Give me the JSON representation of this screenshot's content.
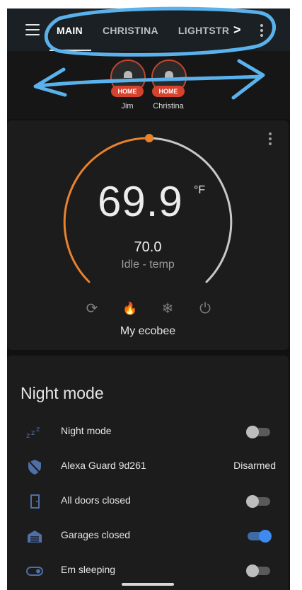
{
  "header": {
    "tabs": [
      {
        "label": "MAIN",
        "active": true
      },
      {
        "label": "CHRISTINA",
        "active": false
      },
      {
        "label": "LIGHTSTR",
        "active": false
      }
    ],
    "chevron": ">",
    "menu_icon": "hamburger-icon",
    "more_icon": "more-vertical-icon"
  },
  "badges": [
    {
      "name": "Jim",
      "state": "HOME"
    },
    {
      "name": "Christina",
      "state": "HOME"
    }
  ],
  "thermostat": {
    "current_temp": "69.9",
    "unit": "°F",
    "target_temp": "70.0",
    "action": "Idle - temp",
    "name": "My ecobee",
    "modes": [
      {
        "icon": "sync-icon",
        "glyph": "⟳",
        "active": false
      },
      {
        "icon": "fire-icon",
        "glyph": "🔥",
        "active": true
      },
      {
        "icon": "snowflake-icon",
        "glyph": "❄",
        "active": false
      },
      {
        "icon": "power-icon",
        "glyph": "⏻",
        "active": false
      }
    ],
    "accent_color": "#e9822d",
    "track_color": "#c8c8c8"
  },
  "entities": {
    "title": "Night mode",
    "rows": [
      {
        "icon": "sleep-icon",
        "label": "Night mode",
        "type": "toggle",
        "on": false
      },
      {
        "icon": "shield-off-icon",
        "label": "Alexa Guard 9d261",
        "type": "state",
        "state": "Disarmed"
      },
      {
        "icon": "door-icon",
        "label": "All doors closed",
        "type": "toggle",
        "on": false
      },
      {
        "icon": "garage-icon",
        "label": "Garages closed",
        "type": "toggle",
        "on": true
      },
      {
        "icon": "toggle-switch-icon",
        "label": "Em sleeping",
        "type": "toggle",
        "on": false
      }
    ]
  },
  "colors": {
    "header_bg": "#1b2025",
    "badge_pill": "#d5432e",
    "toggle_on": "#3d8bf0",
    "annotation_marker": "#5ab2ec"
  }
}
